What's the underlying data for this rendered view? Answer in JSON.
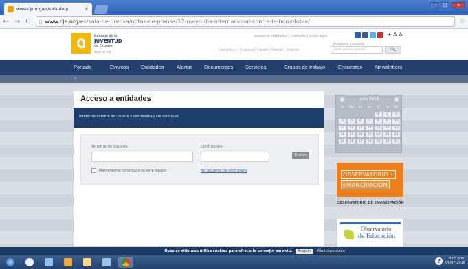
{
  "browser": {
    "tab_title": "www.cje.org/es/sala-de-p",
    "tab_close": "×",
    "url_prefix": "www.cje.org",
    "url_rest": "/es/sala-de-prensa/notas-de-prensa/17-mayo-dia-internacional-contra-la-homofobia/",
    "back": "←",
    "forward": "→",
    "reload": "C",
    "star": "☆",
    "win_min": "-",
    "win_max": "□",
    "win_close": "x"
  },
  "header": {
    "logo_line1": "Consejo de la",
    "logo_line2": "JUVENTUD",
    "logo_line3": "de España",
    "logo_line4": "www.cje.org",
    "top_links": "acceso a entidades  |  contacto  |  aviso legal",
    "text_size": "+ A A",
    "search_label": "Búsqueda avanzada",
    "search_placeholder": "¿Qué quieres buscar?",
    "search_button": "🔍",
    "lang_links": "Castellano | Euskara | Català | Galego | English"
  },
  "nav": {
    "items": [
      "Portada",
      "Eventos",
      "Entidades",
      "Alertas",
      "Documentos",
      "Servicios",
      "Grupos de trabajo",
      "Encuestas",
      "Newsletters"
    ],
    "sub_label": "•"
  },
  "login": {
    "title": "Acceso a entidades",
    "instruction": "Introduce nombre de usuario y contraseña para continuar",
    "username_label": "Nombre de usuario",
    "password_label": "Contraseña",
    "submit": "Enviar",
    "remember_label": "Mantenerme conectado en este equipo",
    "forgot_link": "No recuerdo mi contraseña"
  },
  "calendar": {
    "month": "julio 2016",
    "days_header": [
      "Lu",
      "Ma",
      "Mi",
      "Ju",
      "Vi",
      "Sá",
      "Do"
    ],
    "days": [
      "",
      "",
      "",
      "",
      "1",
      "2",
      "3",
      "4",
      "5",
      "6",
      "7",
      "8",
      "9",
      "10",
      "11",
      "12",
      "13",
      "14",
      "15",
      "16",
      "17",
      "18",
      "19",
      "20",
      "21",
      "22",
      "23",
      "24",
      "25",
      "26",
      "27",
      "28",
      "29",
      "30",
      "31"
    ]
  },
  "sidebar": {
    "obs_em_line1": "OBSERVATORIO •",
    "obs_em_line2": "EMANCIPACIÓN",
    "obs_em_caption": "OBSERVATORIO DE EMANCIPACIÓN",
    "obs_ed_line1": "Observatorio",
    "obs_ed_line2": "de Educación"
  },
  "cookie": {
    "message": "Nuestro sitio web utiliza cookies para ofrecerle un mejor servicio.",
    "accept": "Aceptar",
    "more": "Más información"
  },
  "taskbar": {
    "tray_time": "8:05 p.m.",
    "tray_date": "06/07/2016",
    "help": "?"
  },
  "colors": {
    "nav": "#233f6b",
    "brand_yellow": "#f3b800",
    "emancipacion_orange": "#ee7f1c"
  }
}
